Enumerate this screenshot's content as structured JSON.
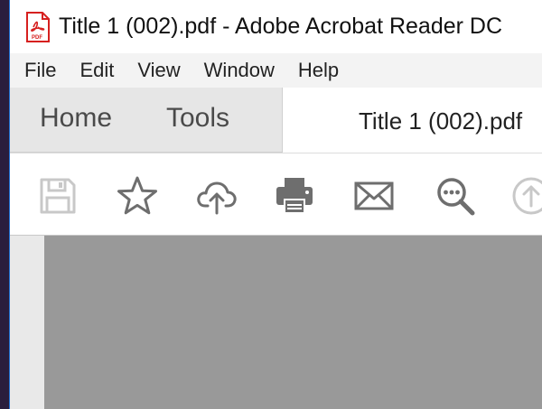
{
  "window": {
    "title": "Title 1 (002).pdf - Adobe Acrobat Reader DC",
    "app_icon": "pdf-file-icon"
  },
  "menu": {
    "items": [
      "File",
      "Edit",
      "View",
      "Window",
      "Help"
    ]
  },
  "tabs": {
    "home_label": "Home",
    "tools_label": "Tools",
    "document_label": "Title 1 (002).pdf"
  },
  "toolbar": {
    "icons": [
      "save-icon",
      "bookmark-star-icon",
      "upload-cloud-icon",
      "print-icon",
      "email-icon",
      "search-icon",
      "upload-arrow-icon"
    ]
  },
  "colors": {
    "accent_red": "#d6201f",
    "icon_gray": "#6e6e6e",
    "canvas_gray": "#999999"
  }
}
